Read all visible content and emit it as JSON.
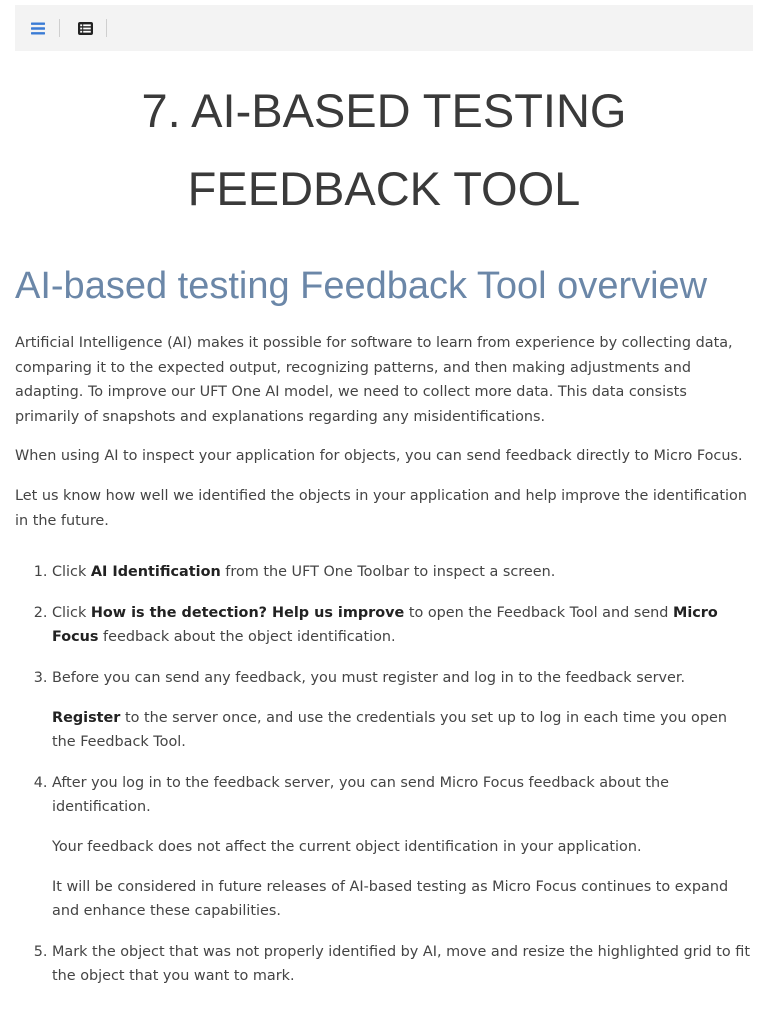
{
  "toolbar": {
    "menu_icon": "hamburger-menu-icon",
    "toc_icon": "list-icon",
    "accent": "#3a7bd5"
  },
  "chapter": {
    "title_line1": "7. AI-BASED TESTING",
    "title_line2": "FEEDBACK TOOL"
  },
  "section": {
    "title": "AI-based testing Feedback Tool overview",
    "title_color": "#6b87a8"
  },
  "intro": {
    "p1": "Artificial Intelligence (AI) makes it possible for software to learn from experience by collecting data, comparing it to the expected output, recognizing patterns, and then making adjustments and adapting. To improve our UFT One AI model, we need to collect more data. This data consists primarily of snapshots and explanations regarding any misidentifications.",
    "p2": "When using AI to inspect your application for objects, you can send feedback directly to Micro Focus.",
    "p3": "Let us know how well we identified the objects in your application and help improve the identification in the future."
  },
  "steps": {
    "s1": {
      "pre": "Click ",
      "bold": "AI Identification",
      "post": " from the UFT One Toolbar to inspect a screen."
    },
    "s2": {
      "pre": "Click ",
      "bold1": "How is the detection? Help us improve",
      "mid": " to open the Feedback Tool and send ",
      "bold2": "Micro Focus",
      "post": " feedback about the object identification."
    },
    "s3": {
      "text": "Before you can send any feedback, you must register and log in to the feedback server.",
      "sub_bold": "Register",
      "sub_post": " to the server once, and use the credentials you set up to log in each time you open the Feedback Tool."
    },
    "s4": {
      "text": "After you log in to the feedback server, you can send Micro Focus feedback about the identification.",
      "sub1": "Your feedback does not affect the current object identification in your application.",
      "sub2": "It will be considered in future releases of AI-based testing as Micro Focus continues to expand and enhance these capabilities."
    },
    "s5": {
      "text": "Mark the object that was not properly identified by AI, move and resize the highlighted grid to fit the object that you want to mark."
    }
  }
}
